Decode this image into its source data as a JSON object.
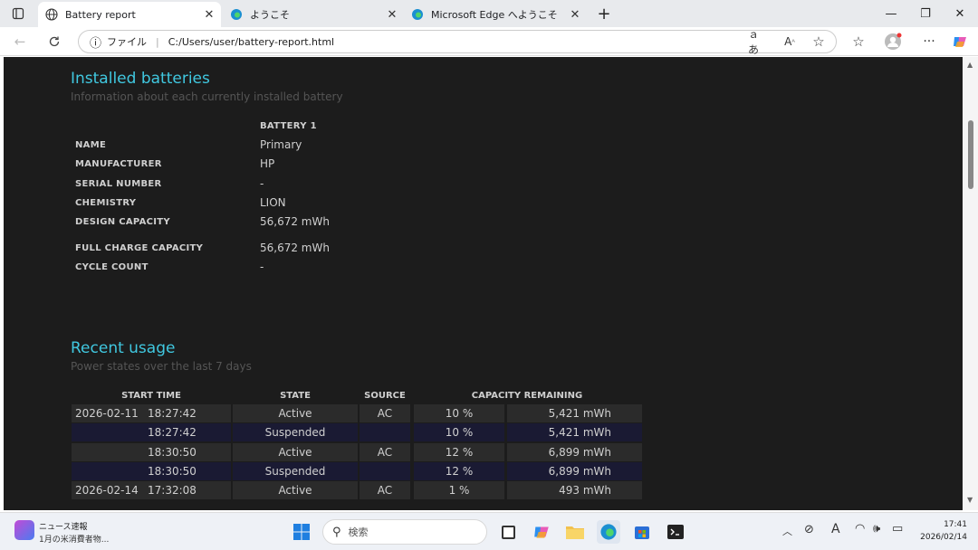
{
  "tabs": [
    {
      "title": "Battery report"
    },
    {
      "title": "ようこそ"
    },
    {
      "title": "Microsoft Edge へようこそ"
    }
  ],
  "address": {
    "scheme_label": "ファイル",
    "url": "C:/Users/user/battery-report.html"
  },
  "installed": {
    "title": "Installed batteries",
    "subtitle": "Information about each currently installed battery",
    "column_header": "BATTERY 1",
    "fields": [
      {
        "label": "NAME",
        "value": "Primary"
      },
      {
        "label": "MANUFACTURER",
        "value": "HP"
      },
      {
        "label": "SERIAL NUMBER",
        "value": "-"
      },
      {
        "label": "CHEMISTRY",
        "value": "LION"
      },
      {
        "label": "DESIGN CAPACITY",
        "value": "56,672 mWh"
      },
      {
        "label": "FULL CHARGE CAPACITY",
        "value": "56,672 mWh"
      },
      {
        "label": "CYCLE COUNT",
        "value": "-"
      }
    ]
  },
  "recent": {
    "title": "Recent usage",
    "subtitle": "Power states over the last 7 days",
    "headers": [
      "START TIME",
      "STATE",
      "SOURCE",
      "CAPACITY REMAINING"
    ],
    "rows": [
      {
        "date": "2026-02-11",
        "time": "18:27:42",
        "state": "Active",
        "source": "AC",
        "pct": "10 %",
        "mwh": "5,421 mWh"
      },
      {
        "date": "",
        "time": "18:27:42",
        "state": "Suspended",
        "source": "",
        "pct": "10 %",
        "mwh": "5,421 mWh"
      },
      {
        "date": "",
        "time": "18:30:50",
        "state": "Active",
        "source": "AC",
        "pct": "12 %",
        "mwh": "6,899 mWh"
      },
      {
        "date": "",
        "time": "18:30:50",
        "state": "Suspended",
        "source": "",
        "pct": "12 %",
        "mwh": "6,899 mWh"
      },
      {
        "date": "2026-02-14",
        "time": "17:32:08",
        "state": "Active",
        "source": "AC",
        "pct": "1 %",
        "mwh": "493 mWh"
      }
    ]
  },
  "taskbar": {
    "news_title": "ニュース速報",
    "news_sub": "1月の米消費者物...",
    "search_placeholder": "検索",
    "time": "17:41",
    "date": "2026/02/14"
  }
}
